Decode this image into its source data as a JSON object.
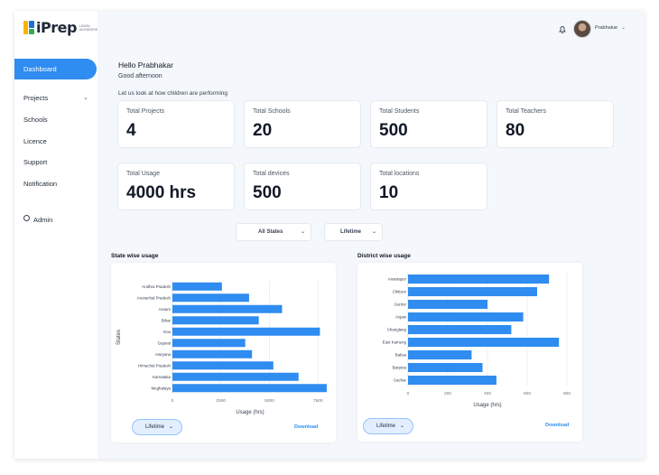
{
  "brand": {
    "name": "iPrep",
    "tagline": "LEARN ANYWHERE"
  },
  "sidebar": {
    "items": [
      {
        "label": "Dashboard",
        "active": true
      },
      {
        "label": "Projects",
        "has_submenu": true
      },
      {
        "label": "Schools"
      },
      {
        "label": "Licence"
      },
      {
        "label": "Support"
      },
      {
        "label": "Notification"
      },
      {
        "label": "Admin",
        "icon": "gear-icon"
      }
    ]
  },
  "topbar": {
    "user_name": "Prabhakar",
    "bell_icon": "bell-icon"
  },
  "greeting": {
    "title": "Hello Prabhakar",
    "subtitle": "Good afternoon",
    "prompt": "Let us look at how children are performing"
  },
  "stats": [
    {
      "label": "Total Projects",
      "value": "4"
    },
    {
      "label": "Total Schools",
      "value": "20"
    },
    {
      "label": "Total Students",
      "value": "500"
    },
    {
      "label": "Total Teachers",
      "value": "80"
    },
    {
      "label": "Total Usage",
      "value": "4000 hrs"
    },
    {
      "label": "Total devices",
      "value": "500"
    },
    {
      "label": "Total locations",
      "value": "10"
    }
  ],
  "filters": {
    "state": "All States",
    "period": "Lifetime"
  },
  "colors": {
    "accent": "#2f8cf0",
    "bar": "#2f8cf0"
  },
  "state_panel": {
    "title": "State wise usage",
    "period_button": "Lifetime",
    "download_label": "Download"
  },
  "district_panel": {
    "title": "District wise usage",
    "period_button": "Lifetime",
    "download_label": "Download"
  },
  "chart_data": [
    {
      "type": "bar",
      "orientation": "horizontal",
      "title": "State wise usage",
      "xlabel": "Usage (hrs)",
      "ylabel": "States",
      "categories": [
        "Andhra Pradesh",
        "Arunachal Pradesh",
        "Assam",
        "Bihar",
        "Goa",
        "Gujarat",
        "Haryana",
        "Himachal Pradesh",
        "Karnataka",
        "Meghalaya"
      ],
      "values": [
        2550,
        3950,
        5650,
        4450,
        7600,
        3750,
        4100,
        5200,
        6500,
        7950
      ],
      "xlim": [
        0,
        8000
      ],
      "xticks": [
        "0",
        "2500",
        "5000",
        "7500"
      ],
      "grid": true
    },
    {
      "type": "bar",
      "orientation": "horizontal",
      "title": "District wise usage",
      "xlabel": "Usage (hrs)",
      "categories": [
        "Anantapur",
        "Chittoor",
        "Guntur",
        "Anjaw",
        "Changlang",
        "East Kameng",
        "Baksa",
        "Barpeta",
        "Cachar"
      ],
      "values": [
        710,
        650,
        400,
        580,
        520,
        760,
        320,
        375,
        445
      ],
      "xlim": [
        0,
        800
      ],
      "xticks": [
        "0",
        "200",
        "400",
        "600",
        "800"
      ],
      "grid": true
    }
  ]
}
